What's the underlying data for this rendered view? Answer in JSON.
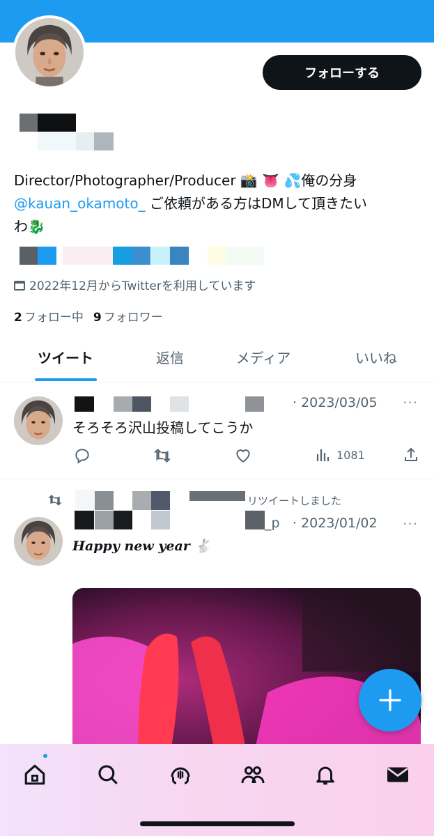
{
  "header": {
    "follow_label": "フォローする"
  },
  "profile": {
    "bio_line1": "Director/Photographer/Producer 📸 👅 💦俺の分身",
    "bio_mention": "@kauan_okamoto_",
    "bio_line2_rest": " ご依頼がある方はDMして頂きたい",
    "bio_line3": "わ🐉",
    "joined": "2022年12月からTwitterを利用しています",
    "following_count": "2",
    "following_label": "フォロー中",
    "followers_count": "9",
    "followers_label": "フォロワー"
  },
  "tabs": [
    "ツイート",
    "返信",
    "メディア",
    "いいね"
  ],
  "tweets": [
    {
      "handle_fragment": "kauan_okamoto_p",
      "date": "· 2023/03/05",
      "text": "そろそろ沢山投稿してこうか",
      "views": "1081"
    },
    {
      "retweet_label": "リツイートしました",
      "handle_fragment": "_p",
      "date": "· 2023/01/02",
      "text": "Happy new year 🐇"
    }
  ],
  "icons": {
    "more": "more-dots-icon",
    "reply": "reply-icon",
    "retweet": "retweet-icon",
    "like": "like-icon",
    "views": "views-icon",
    "share": "share-icon",
    "nav": [
      "home-icon",
      "search-icon",
      "spaces-icon",
      "communities-icon",
      "notifications-icon",
      "messages-icon"
    ],
    "compose": "compose-plus-icon"
  },
  "colors": {
    "accent": "#1d9bf0",
    "text": "#0f1419",
    "secondary": "#536471"
  }
}
